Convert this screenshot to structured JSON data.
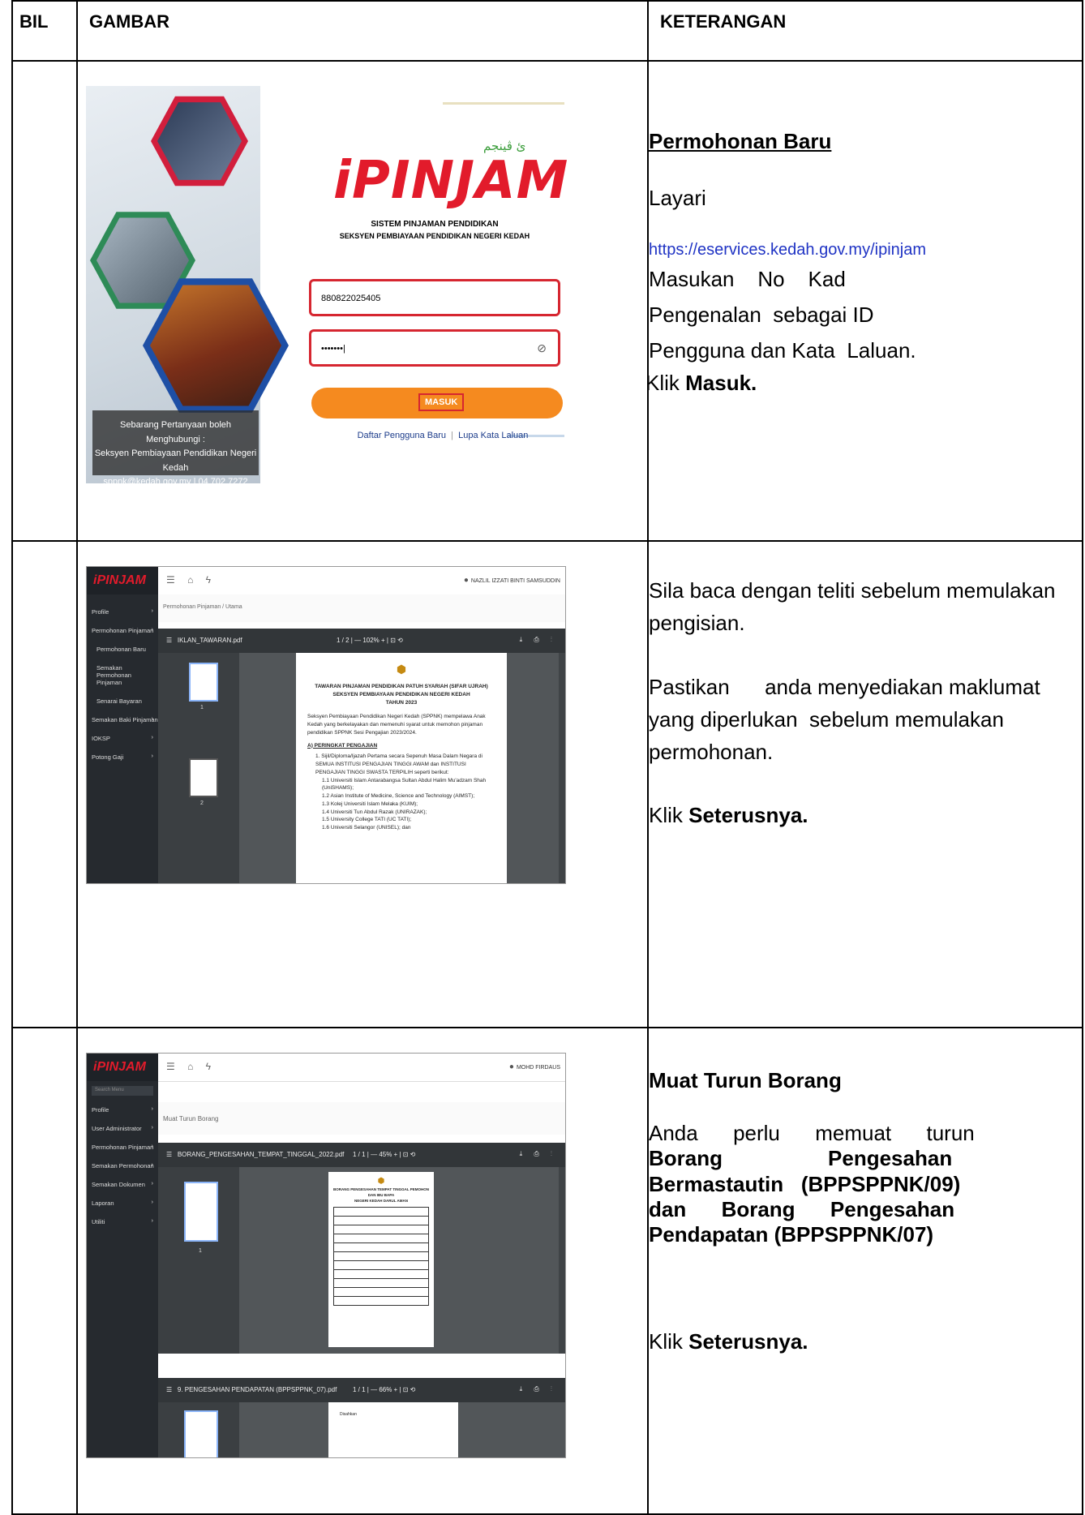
{
  "headers": {
    "bil": "BIL",
    "gambar": "GAMBAR",
    "keterangan": "KETERANGAN"
  },
  "rows": [
    {
      "login": {
        "jawi": "ئ ڤينجم",
        "logo": "iPINJAM",
        "sub1": "SISTEM PINJAMAN PENDIDIKAN",
        "sub2": "SEKSYEN PEMBIAYAAN PENDIDIKAN NEGERI KEDAH",
        "ic_value": "880822025405",
        "password_value": "•••••••|",
        "button": "MASUK",
        "link_register": "Daftar Pengguna Baru",
        "link_sep": "|",
        "link_forgot": "Lupa Kata Laluan",
        "contact_1": "Sebarang Pertanyaan boleh Menghubungi :",
        "contact_2": "Seksyen Pembiayaan Pendidikan Negeri Kedah",
        "contact_3": "sppnk@kedah.gov.my | 04 702 7272"
      },
      "ket": {
        "title": "Permohonan Baru",
        "p1": "Layari",
        "url": "https://eservices.kedah.gov.my/ipinjam",
        "p2": "Masukan    No    Kad",
        "p3": "Pengenalan  sebagai ID",
        "p4": "Pengguna dan Kata  Laluan.",
        "p5_pre": "Klik ",
        "p5_bold": "Masuk."
      }
    },
    {
      "app": {
        "brand": "iPINJAM",
        "user": "NAZLIL IZZATI BINTI SAMSUDDIN",
        "crumb": "Permohonan Pinjaman / Utama",
        "menu": [
          "Profile",
          "Permohonan Pinjaman",
          "Permohonan Baru",
          "Semakan Permohonan Pinjaman",
          "Senarai Bayaran",
          "Semakan Baki Pinjaman",
          "IOKSP",
          "Potong Gaji"
        ],
        "file": "IKLAN_TAWARAN.pdf",
        "pages": "1 / 2  |  —  102%  +  |  ⊡  ⟲",
        "thumb1": "1",
        "thumb2": "2",
        "pdf_title1": "TAWARAN PINJAMAN PENDIDIKAN PATUH SYARIAH (SIFAR UJRAH)",
        "pdf_title2": "SEKSYEN PEMBIAYAAN PENDIDIKAN NEGERI KEDAH",
        "pdf_title3": "TAHUN 2023",
        "pdf_para": "Seksyen Pembiayaan Pendidikan Negeri Kedah (SPPNK) mempelawa Anak Kedah yang berkelayakan dan memenuhi syarat untuk memohon pinjaman pendidikan SPPNK Sesi Pengajian 2023/2024.",
        "pdf_h": "A) PERINGKAT PENGAJIAN",
        "pdf_items": [
          "1. Sijil/Diploma/Ijazah Pertama secara Sepenuh Masa Dalam Negara di SEMUA INSTITUSI PENGAJIAN TINGGI AWAM dan INSTITUSI PENGAJIAN TINGGI SWASTA TERPILIH seperti berikut:",
          "1.1 Universiti Islam Antarabangsa Sultan Abdul Halim Mu'adzam Shah (UniSHAMS);",
          "1.2 Asian Institute of Medicine, Science and Technology (AIMST);",
          "1.3 Kolej Universiti Islam Melaka (KUIM);",
          "1.4 Universiti Tun Abdul Razak (UNIRAZAK);",
          "1.5 University College TATI (UC TATI);",
          "1.6 Universiti Selangor (UNISEL); dan"
        ]
      },
      "ket": {
        "p1": "Sila baca dengan teliti sebelum memulakan pengisian.",
        "p2": "Pastikan      anda menyediakan maklumat yang diperlukan  sebelum memulakan  permohonan.",
        "p3_pre": "Klik ",
        "p3_bold": "Seterusnya."
      }
    },
    {
      "app": {
        "brand": "iPINJAM",
        "user": "MOHD FIRDAUS",
        "search_placeholder": "Search Menu",
        "crumb": "Muat Turun Borang",
        "menu": [
          "Profile",
          "User Administrator",
          "Permohonan Pinjaman",
          "Semakan Permohonan",
          "Semakan Dokumen",
          "Laporan",
          "Utiliti"
        ],
        "file1": "BORANG_PENGESAHAN_TEMPAT_TINGGAL_2022.pdf",
        "pages1": "1 / 1  |  —  45%  +  |  ⊡  ⟲",
        "thumb1": "1",
        "form_title1": "BORANG PENGESAHAN TEMPAT TINGGAL PEMOHON DAN IBU BAPA",
        "form_title2": "NEGERI KEDAH DARUL AMAN",
        "file2": "9. PENGESAHAN PENDAPATAN (BPPSPPNK_07).pdf",
        "pages2": "1 / 1  |  —  66%  +  |  ⊡  ⟲",
        "form2_label": "Disahkan"
      },
      "ket": {
        "title": "Muat Turun Borang",
        "p1": "Anda      perlu      memuat      turun",
        "p2": "Borang                  Pengesahan",
        "p3": "Bermastautin   (BPPSPPNK/09)",
        "p4": "dan      Borang      Pengesahan",
        "p5": "Pendapatan (BPPSPPNK/07)",
        "p6_pre": "Klik ",
        "p6_bold": "Seterusnya."
      }
    }
  ]
}
